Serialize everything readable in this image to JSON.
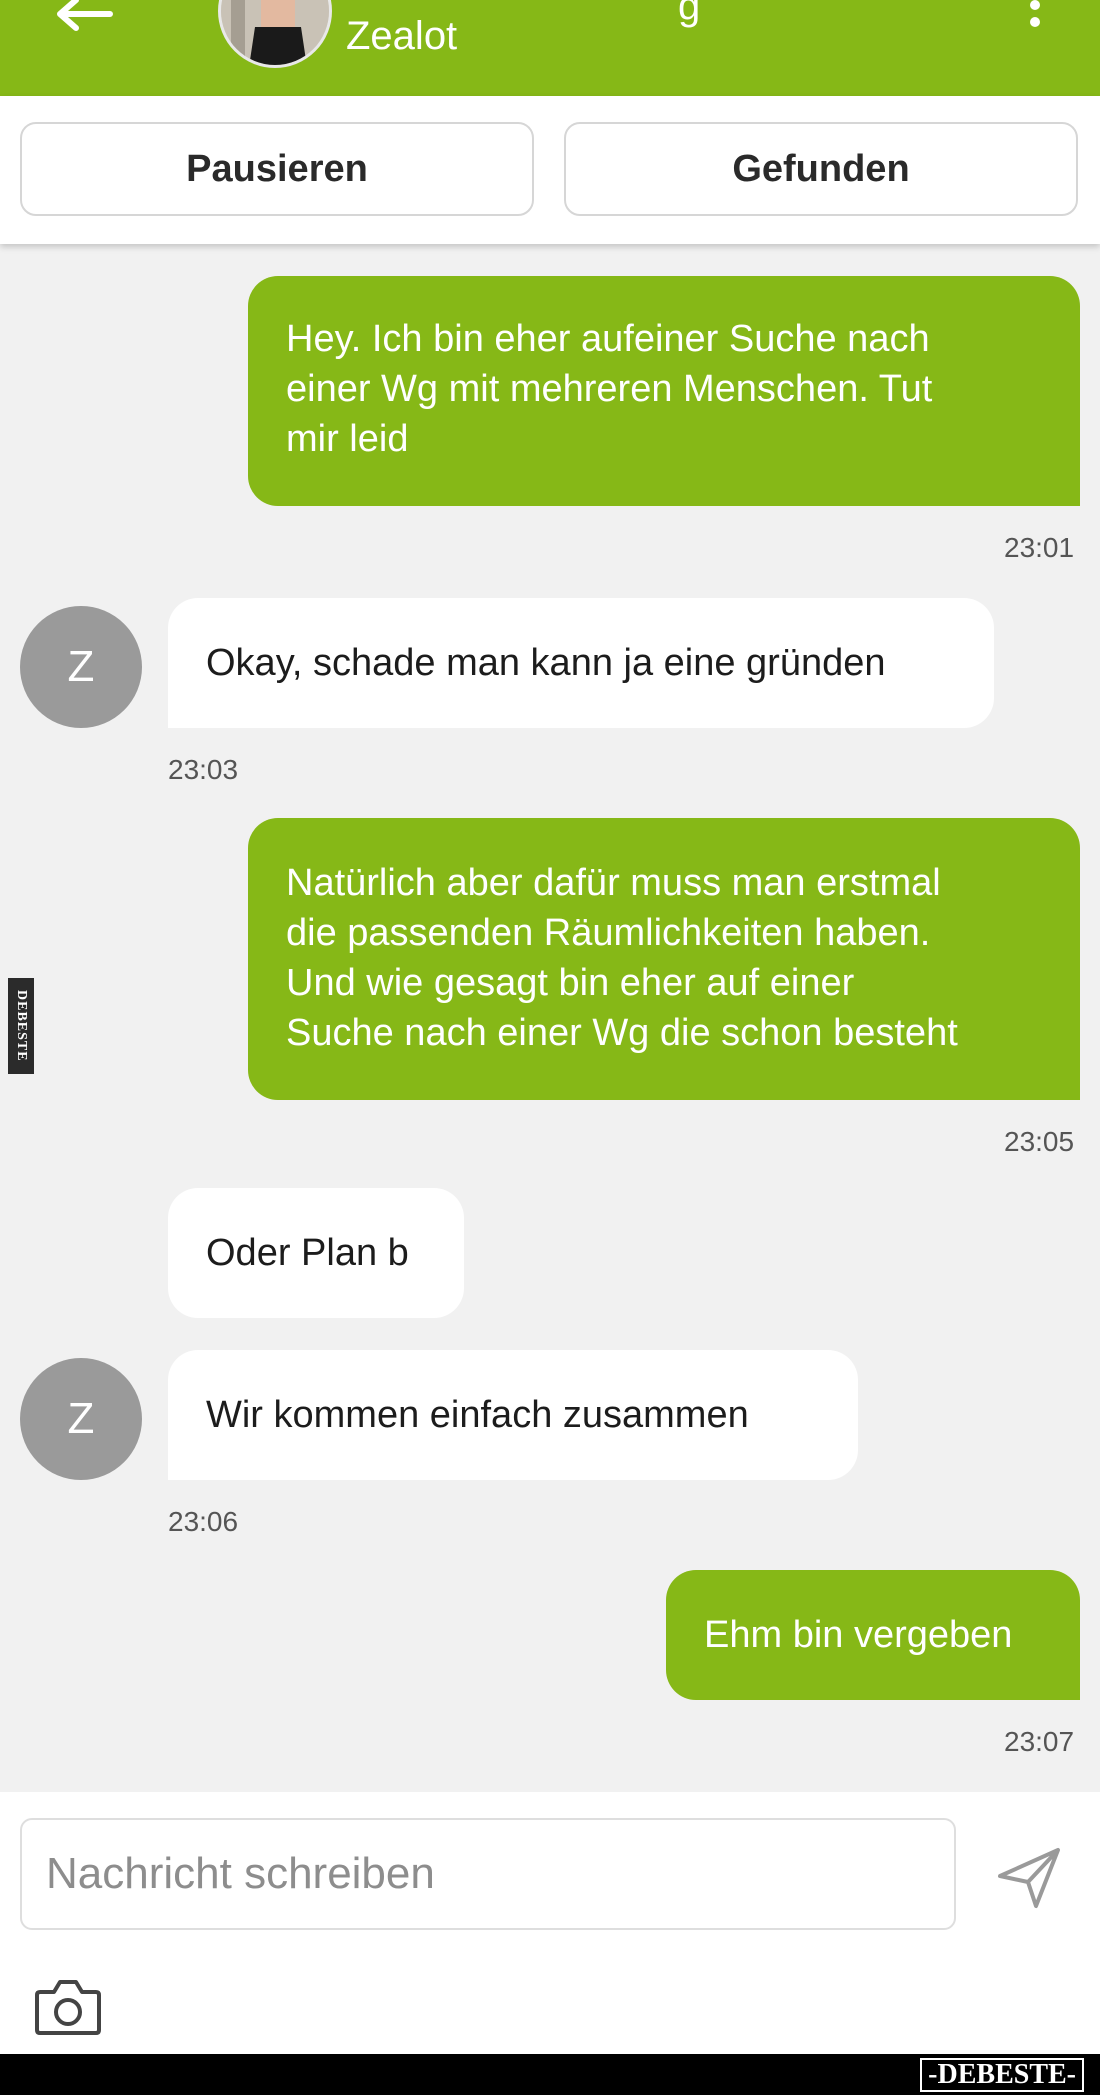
{
  "header": {
    "contact_name": "Zealot",
    "title_partial": "g",
    "back_icon": "arrow-left-icon",
    "menu_icon": "more-vertical-icon"
  },
  "actions": {
    "pause_label": "Pausieren",
    "found_label": "Gefunden"
  },
  "messages": [
    {
      "from": "me",
      "text_lines": [
        "Hey. Ich bin eher aufeiner Suche nach",
        "einer Wg mit mehreren Menschen. Tut",
        "mir leid"
      ],
      "time": "23:01"
    },
    {
      "from": "Z",
      "text": "Okay, schade man kann ja eine gründen",
      "time": "23:03"
    },
    {
      "from": "me",
      "text_lines": [
        "Natürlich aber dafür muss man erstmal",
        "die passenden Räumlichkeiten haben.",
        "Und wie gesagt bin eher auf einer",
        "Suche nach einer Wg die schon besteht"
      ],
      "time": "23:05"
    },
    {
      "from": "Z",
      "text": "Oder Plan b"
    },
    {
      "from": "Z",
      "text": "Wir kommen einfach zusammen",
      "time": "23:06"
    },
    {
      "from": "me",
      "text": "Ehm bin vergeben",
      "time": "23:07"
    }
  ],
  "avatar_letter": "Z",
  "composer": {
    "placeholder": "Nachricht schreiben",
    "send_icon": "send-icon",
    "camera_icon": "camera-icon"
  },
  "watermark": {
    "footer": "-DEBESTE-",
    "side": "DEBESTE"
  },
  "colors": {
    "accent": "#86b817",
    "background": "#f1f1f1"
  }
}
